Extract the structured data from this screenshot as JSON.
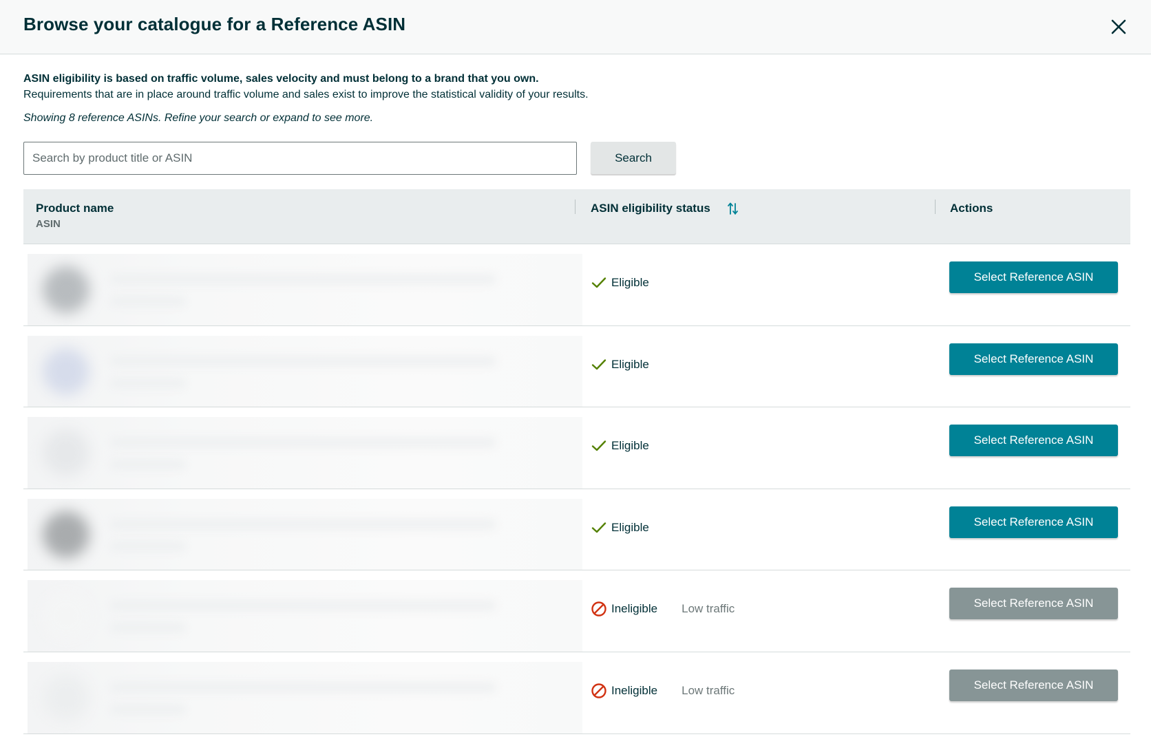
{
  "header": {
    "title": "Browse your catalogue for a Reference ASIN",
    "close_icon": "close-icon"
  },
  "intro": {
    "bold": "ASIN eligibility is based on traffic volume, sales velocity and must belong to a brand that you own.",
    "text": "Requirements that are in place around traffic volume and sales exist to improve the statistical validity of your results.",
    "showing": "Showing 8 reference ASINs. Refine your search or expand to see more."
  },
  "search": {
    "placeholder": "Search by product title or ASIN",
    "value": "",
    "button_label": "Search"
  },
  "table": {
    "columns": {
      "product_name": "Product name",
      "product_sub": "ASIN",
      "status": "ASIN eligibility status",
      "status_sort_icon": "sort-icon",
      "actions": "Actions"
    },
    "rows": [
      {
        "status": "Eligible",
        "status_icon": "check-icon",
        "reason": "",
        "action": "Select Reference ASIN",
        "enabled": true,
        "thumb_color": "#b8bcbf"
      },
      {
        "status": "Eligible",
        "status_icon": "check-icon",
        "reason": "",
        "action": "Select Reference ASIN",
        "enabled": true,
        "thumb_color": "#d6dceb"
      },
      {
        "status": "Eligible",
        "status_icon": "check-icon",
        "reason": "",
        "action": "Select Reference ASIN",
        "enabled": true,
        "thumb_color": "#e6e8ea"
      },
      {
        "status": "Eligible",
        "status_icon": "check-icon",
        "reason": "",
        "action": "Select Reference ASIN",
        "enabled": true,
        "thumb_color": "#a9acae"
      },
      {
        "status": "Ineligible",
        "status_icon": "prohibited-icon",
        "reason": "Low traffic",
        "action": "Select Reference ASIN",
        "enabled": false,
        "thumb_color": "#f4f5f5"
      },
      {
        "status": "Ineligible",
        "status_icon": "prohibited-icon",
        "reason": "Low traffic",
        "action": "Select Reference ASIN",
        "enabled": false,
        "thumb_color": "#eceeef"
      }
    ]
  },
  "colors": {
    "primary": "#008296",
    "disabled": "#879596",
    "eligible": "#538000",
    "ineligible": "#d13212",
    "title": "#002f36"
  }
}
